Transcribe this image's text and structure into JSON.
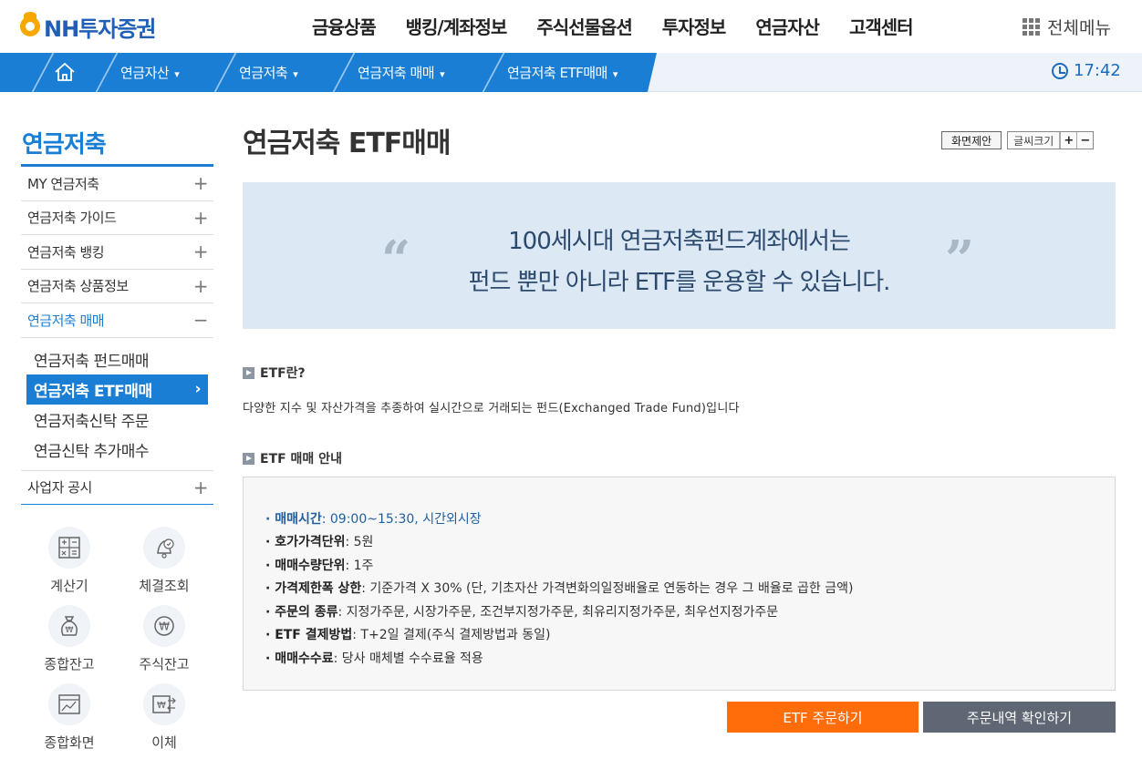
{
  "header": {
    "logo_text": "NH투자증권",
    "gnb": [
      "금융상품",
      "뱅킹/계좌정보",
      "주식선물옵션",
      "투자정보",
      "연금자산",
      "고객센터"
    ],
    "all_menu_label": "전체메뉴"
  },
  "location": {
    "items": [
      "연금자산",
      "연금저축",
      "연금저축 매매",
      "연금저축 ETF매매"
    ],
    "time": "17:42"
  },
  "sidebar": {
    "title": "연금저축",
    "items": [
      {
        "label": "MY 연금저축",
        "toggle": "+"
      },
      {
        "label": "연금저축 가이드",
        "toggle": "+"
      },
      {
        "label": "연금저축 뱅킹",
        "toggle": "+"
      },
      {
        "label": "연금저축 상품정보",
        "toggle": "+"
      },
      {
        "label": "연금저축 매매",
        "toggle": "−"
      }
    ],
    "sub_items": [
      "연금저축 펀드매매",
      "연금저축 ETF매매",
      "연금저축신탁 주문",
      "연금신탁 추가매수"
    ],
    "sub_active_arrow": "›",
    "last_item": {
      "label": "사업자 공시",
      "toggle": "+"
    },
    "quick": [
      "계산기",
      "체결조회",
      "종합잔고",
      "주식잔고",
      "종합화면",
      "이체"
    ]
  },
  "main": {
    "title": "연금저축 ETF매매",
    "screen_suggest": "화면제안",
    "font_size_label": "글씨크기",
    "font_plus": "+",
    "font_minus": "−",
    "banner": {
      "quote_open": "“",
      "quote_close": "”",
      "line1": "100세시대 연금저축펀드계좌에서는",
      "line2": "펀드 뿐만 아니라 ETF를 운용할 수 있습니다."
    },
    "section1": {
      "heading": "ETF란?",
      "desc": "다양한 지수 및 자산가격을 추종하여 실시간으로 거래되는 펀드(Exchanged Trade Fund)입니다"
    },
    "section2": {
      "heading": "ETF 매매 안내",
      "items": [
        {
          "key": "· 매매시간",
          "value": " : 09:00~15:30, 시간외시장"
        },
        {
          "key": "· 호가가격단위",
          "value": " : 5원"
        },
        {
          "key": "· 매매수량단위",
          "value": " : 1주"
        },
        {
          "key": "· 가격제한폭 상한",
          "value": " : 기준가격 X 30% (단, 기초자산 가격변화의일정배율로 연동하는 경우 그 배율로 곱한 금액)"
        },
        {
          "key": "· 주문의 종류",
          "value": " : 지정가주문, 시장가주문, 조건부지정가주문, 최유리지정가주문, 최우선지정가주문"
        },
        {
          "key": "· ETF 결제방법",
          "value": " : T+2일 결제(주식 결제방법과 동일)"
        },
        {
          "key": "· 매매수수료",
          "value": " : 당사 매체별 수수료율 적용"
        }
      ]
    },
    "buttons": {
      "order": "ETF 주문하기",
      "history": "주문내역 확인하기"
    }
  }
}
